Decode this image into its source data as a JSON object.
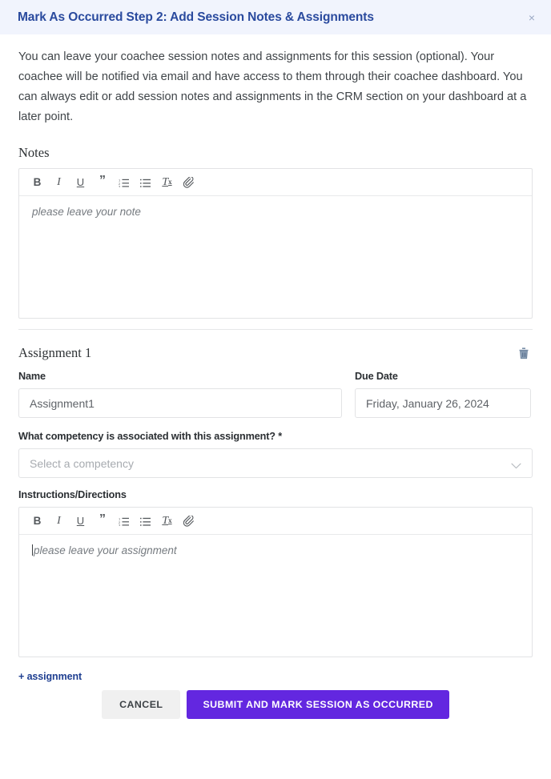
{
  "modal": {
    "title": "Mark As Occurred Step 2: Add Session Notes & Assignments",
    "close_label": "×",
    "close_icon": "close-icon",
    "intro": "You can leave your coachee session notes and assignments for this session (optional). Your coachee will be notified via email and have access to them through their coachee dashboard. You can always edit or add session notes and assignments in the CRM section on your dashboard at a later point."
  },
  "notes": {
    "label": "Notes",
    "placeholder": "please leave your note"
  },
  "toolbar": {
    "bold": "B",
    "italic": "I",
    "underline": "U",
    "quote": "”",
    "ordered_list": "ordered-list-icon",
    "unordered_list": "unordered-list-icon",
    "remove_format": "T",
    "remove_format_sub": "x",
    "attachment": "paperclip-icon"
  },
  "assignment": {
    "title": "Assignment 1",
    "delete_icon": "trash-icon",
    "name_label": "Name",
    "name_value": "Assignment1",
    "due_date_label": "Due Date",
    "due_date_value": "Friday, January 26, 2024",
    "competency_label": "What competency is associated with this assignment? *",
    "competency_placeholder": "Select a competency",
    "instructions_label": "Instructions/Directions",
    "instructions_placeholder": "please leave your assignment"
  },
  "footer": {
    "add_assignment": "+ assignment",
    "cancel": "CANCEL",
    "submit": "SUBMIT AND MARK SESSION AS OCCURRED"
  },
  "colors": {
    "header_bg": "#f1f4fd",
    "title_blue": "#2a4a9e",
    "accent_purple": "#6327e0",
    "link_blue": "#1f3f91",
    "trash_blue": "#7a8fa8"
  }
}
